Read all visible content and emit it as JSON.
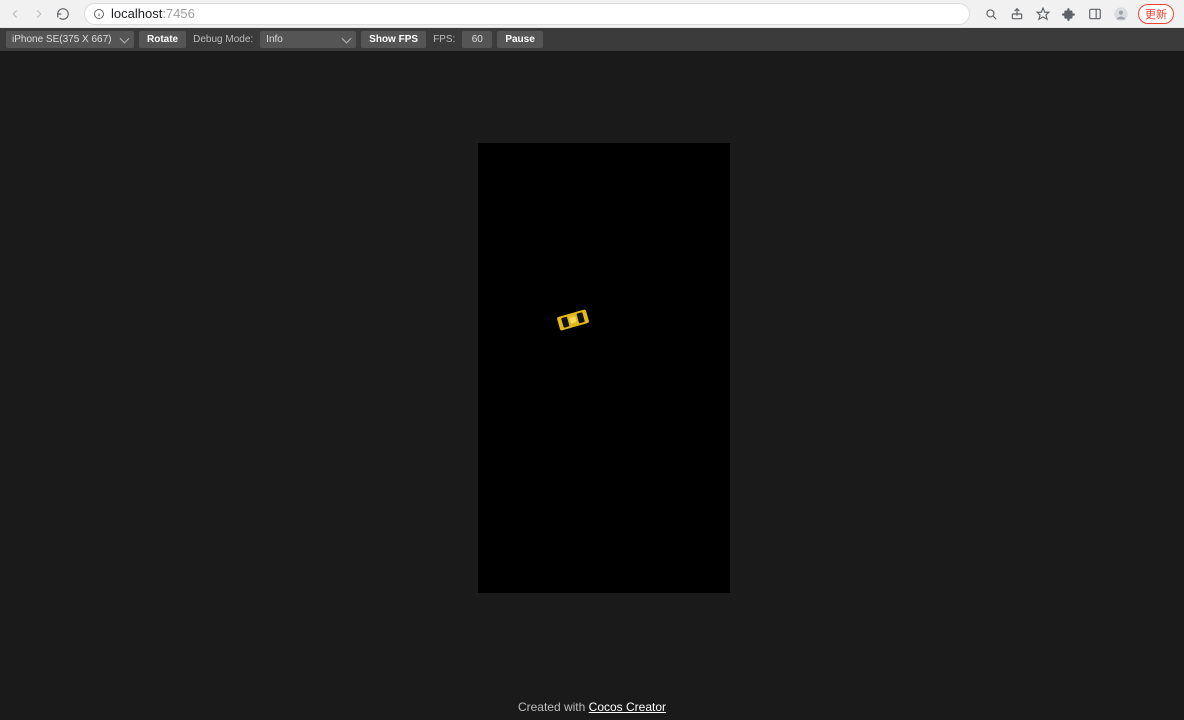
{
  "browser": {
    "url_host": "localhost",
    "url_port": ":7456",
    "update_label": "更新"
  },
  "toolbar": {
    "device_selected": "iPhone SE(375 X 667)",
    "rotate_label": "Rotate",
    "debug_mode_label": "Debug Mode:",
    "debug_mode_selected": "Info",
    "show_fps_label": "Show FPS",
    "fps_label": "FPS:",
    "fps_value": "60",
    "pause_label": "Pause"
  },
  "footer": {
    "prefix": "Created with ",
    "link_text": "Cocos Creator"
  }
}
